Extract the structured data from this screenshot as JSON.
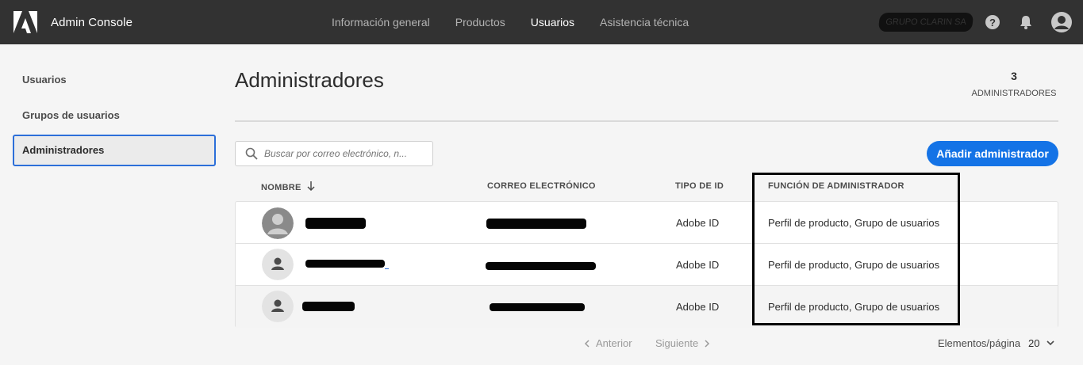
{
  "app": {
    "title": "Admin Console"
  },
  "nav": {
    "items": [
      {
        "label": "Información general"
      },
      {
        "label": "Productos"
      },
      {
        "label": "Usuarios"
      },
      {
        "label": "Asistencia técnica"
      }
    ],
    "active_index": 2,
    "org_name": "GRUPO CLARIN SA"
  },
  "sidebar": {
    "items": [
      {
        "label": "Usuarios"
      },
      {
        "label": "Grupos de usuarios"
      },
      {
        "label": "Administradores"
      }
    ],
    "active_index": 2
  },
  "page": {
    "title": "Administradores",
    "count": "3",
    "count_label": "ADMINISTRADORES"
  },
  "search": {
    "placeholder": "Buscar por correo electrónico, n..."
  },
  "add_button": {
    "label": "Añadir administrador"
  },
  "table": {
    "columns": [
      {
        "label": "NOMBRE"
      },
      {
        "label": "CORREO ELECTRÓNICO"
      },
      {
        "label": "TIPO DE ID"
      },
      {
        "label": "FUNCIÓN DE ADMINISTRADOR"
      }
    ],
    "rows": [
      {
        "id_type": "Adobe ID",
        "role": "Perfil de producto, Grupo de usuarios"
      },
      {
        "id_type": "Adobe ID",
        "role": "Perfil de producto, Grupo de usuarios"
      },
      {
        "id_type": "Adobe ID",
        "role": "Perfil de producto, Grupo de usuarios"
      }
    ]
  },
  "pagination": {
    "prev_label": "Anterior",
    "next_label": "Siguiente",
    "per_page_label": "Elementos/página",
    "per_page_value": "20"
  },
  "colors": {
    "accent": "#1473e6",
    "topbar": "#323232"
  }
}
